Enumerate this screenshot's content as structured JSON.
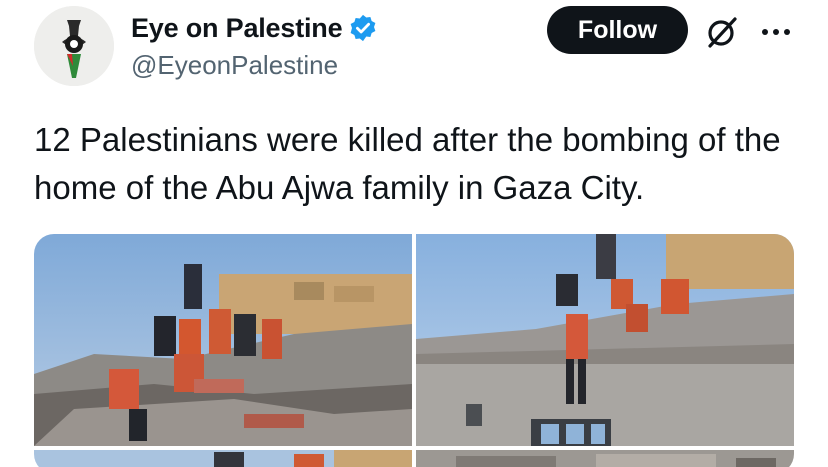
{
  "author": {
    "display_name": "Eye on Palestine",
    "handle": "@EyeonPalestine",
    "verified": true,
    "avatar_icon": "eye-flag-logo-icon"
  },
  "actions": {
    "follow_label": "Follow",
    "grok_icon": "grok-icon",
    "more_icon": "more-options-icon"
  },
  "tweet": {
    "text": "12 Palestinians were killed after the bombing of the home of the Abu Ajwa family in Gaza City."
  },
  "media": {
    "photos": [
      "photo-rescue-rubble-1",
      "photo-rescue-rubble-2",
      "photo-rubble-3",
      "photo-rubble-4"
    ]
  },
  "colors": {
    "text_primary": "#0f1419",
    "text_secondary": "#536471",
    "verified_blue": "#1d9bf0",
    "follow_bg": "#0f1419"
  }
}
